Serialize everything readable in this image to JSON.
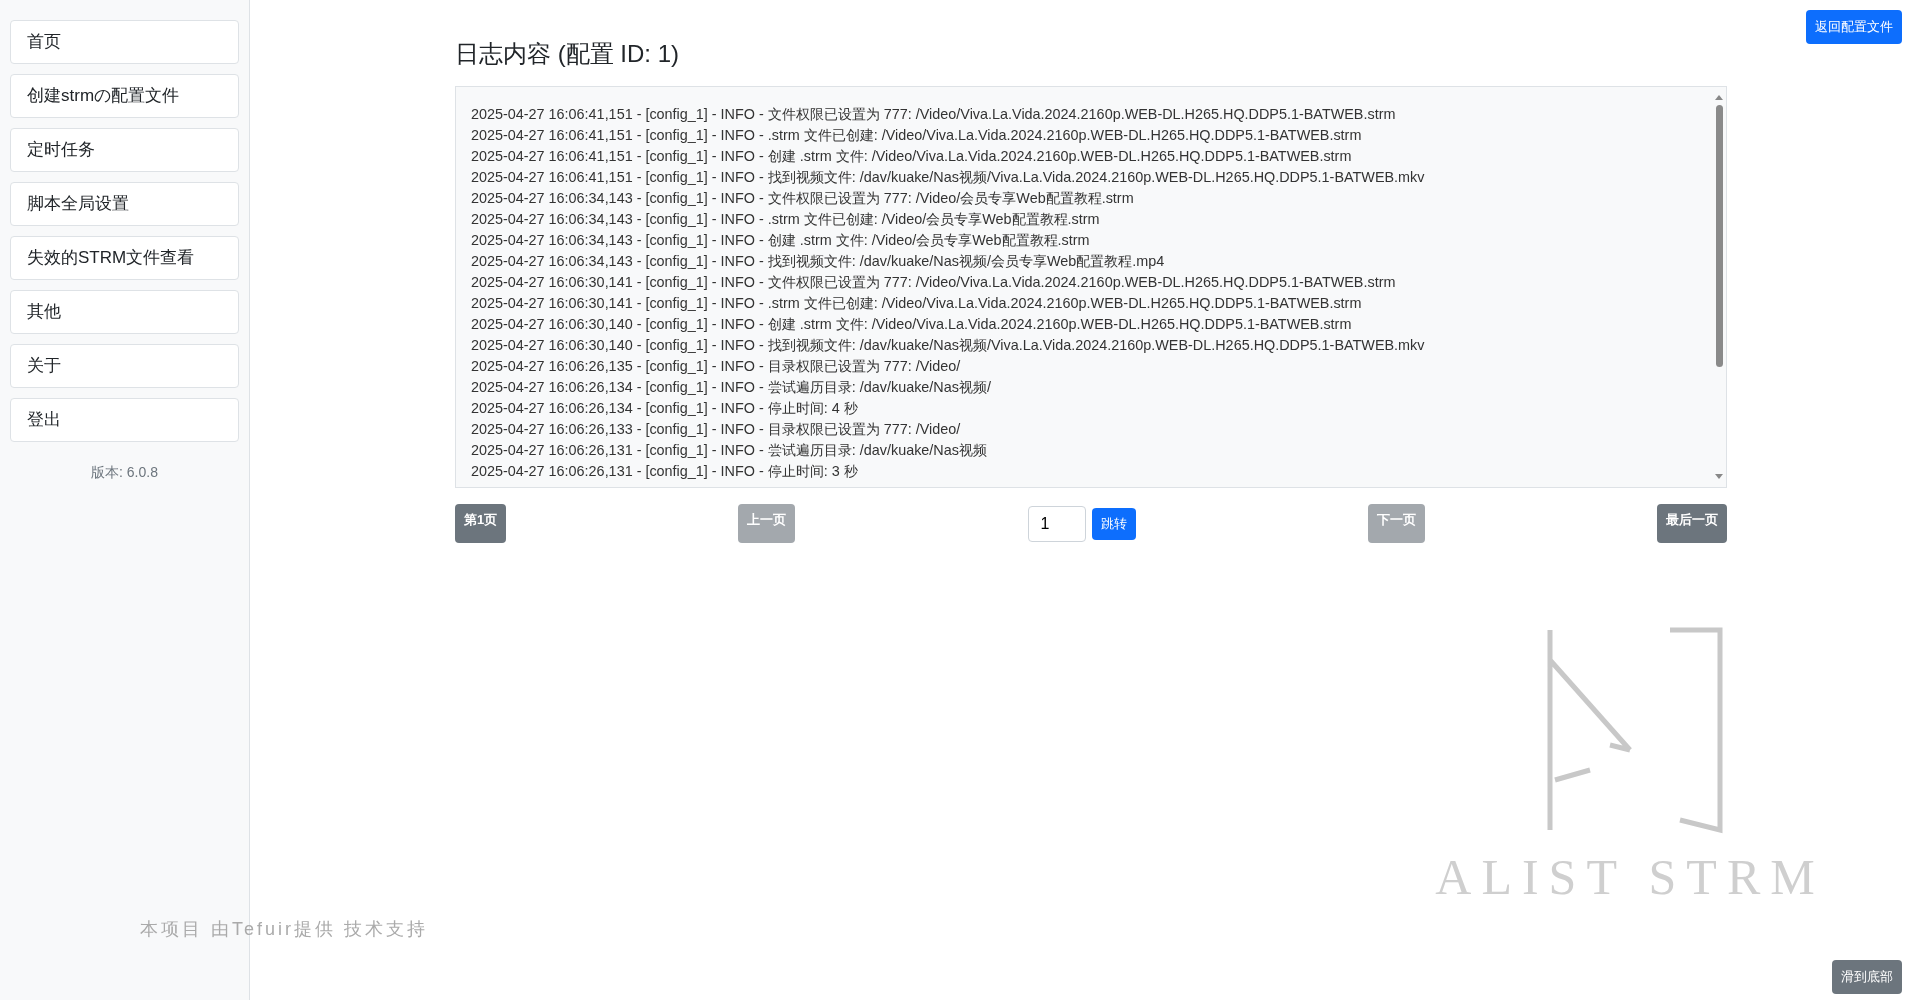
{
  "sidebar": {
    "items": [
      {
        "label": "首页"
      },
      {
        "label": "创建strmの配置文件"
      },
      {
        "label": "定时任务"
      },
      {
        "label": "脚本全局设置"
      },
      {
        "label": "失效的STRM文件查看"
      },
      {
        "label": "其他"
      },
      {
        "label": "关于"
      },
      {
        "label": "登出"
      }
    ],
    "version": "版本: 6.0.8"
  },
  "top_button": "返回配置文件",
  "title": "日志内容 (配置 ID: 1)",
  "log_lines": [
    "2025-04-27 16:06:41,151 - [config_1] - INFO - 文件权限已设置为 777: /Video/Viva.La.Vida.2024.2160p.WEB-DL.H265.HQ.DDP5.1-BATWEB.strm",
    "2025-04-27 16:06:41,151 - [config_1] - INFO - .strm 文件已创建: /Video/Viva.La.Vida.2024.2160p.WEB-DL.H265.HQ.DDP5.1-BATWEB.strm",
    "2025-04-27 16:06:41,151 - [config_1] - INFO - 创建 .strm 文件: /Video/Viva.La.Vida.2024.2160p.WEB-DL.H265.HQ.DDP5.1-BATWEB.strm",
    "2025-04-27 16:06:41,151 - [config_1] - INFO - 找到视频文件: /dav/kuake/Nas视频/Viva.La.Vida.2024.2160p.WEB-DL.H265.HQ.DDP5.1-BATWEB.mkv",
    "2025-04-27 16:06:34,143 - [config_1] - INFO - 文件权限已设置为 777: /Video/会员专享Web配置教程.strm",
    "2025-04-27 16:06:34,143 - [config_1] - INFO - .strm 文件已创建: /Video/会员专享Web配置教程.strm",
    "2025-04-27 16:06:34,143 - [config_1] - INFO - 创建 .strm 文件: /Video/会员专享Web配置教程.strm",
    "2025-04-27 16:06:34,143 - [config_1] - INFO - 找到视频文件: /dav/kuake/Nas视频/会员专享Web配置教程.mp4",
    "2025-04-27 16:06:30,141 - [config_1] - INFO - 文件权限已设置为 777: /Video/Viva.La.Vida.2024.2160p.WEB-DL.H265.HQ.DDP5.1-BATWEB.strm",
    "2025-04-27 16:06:30,141 - [config_1] - INFO - .strm 文件已创建: /Video/Viva.La.Vida.2024.2160p.WEB-DL.H265.HQ.DDP5.1-BATWEB.strm",
    "2025-04-27 16:06:30,140 - [config_1] - INFO - 创建 .strm 文件: /Video/Viva.La.Vida.2024.2160p.WEB-DL.H265.HQ.DDP5.1-BATWEB.strm",
    "2025-04-27 16:06:30,140 - [config_1] - INFO - 找到视频文件: /dav/kuake/Nas视频/Viva.La.Vida.2024.2160p.WEB-DL.H265.HQ.DDP5.1-BATWEB.mkv",
    "2025-04-27 16:06:26,135 - [config_1] - INFO - 目录权限已设置为 777: /Video/",
    "2025-04-27 16:06:26,134 - [config_1] - INFO - 尝试遍历目录: /dav/kuake/Nas视频/",
    "2025-04-27 16:06:26,134 - [config_1] - INFO - 停止时间: 4 秒",
    "2025-04-27 16:06:26,133 - [config_1] - INFO - 目录权限已设置为 777: /Video/",
    "2025-04-27 16:06:26,131 - [config_1] - INFO - 尝试遍历目录: /dav/kuake/Nas视频",
    "2025-04-27 16:06:26,131 - [config_1] - INFO - 停止时间: 3 秒"
  ],
  "pagination": {
    "first": {
      "label": "第1页",
      "disabled": false
    },
    "prev": {
      "label": "上一页",
      "disabled": true
    },
    "page_input": "1",
    "jump": "跳转",
    "next": {
      "label": "下一页",
      "disabled": true
    },
    "last": {
      "label": "最后一页",
      "disabled": false
    }
  },
  "footer": "本项目 由Tefuir提供 技术支持",
  "logo_text": "ALIST STRM",
  "bottom_button": "滑到底部"
}
